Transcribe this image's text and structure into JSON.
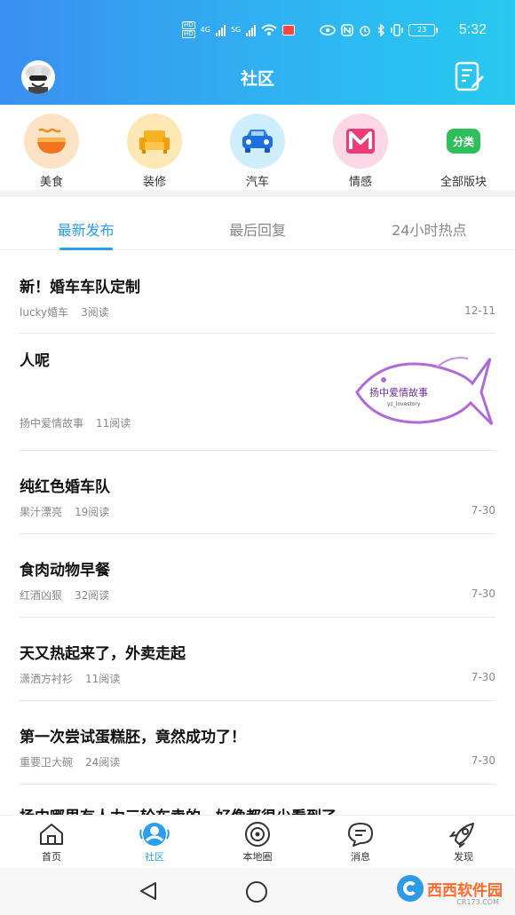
{
  "status_bar": {
    "hd1": "HD",
    "net1": "4G",
    "net2": "5G",
    "battery": "23",
    "time": "5:32"
  },
  "header": {
    "title": "社区"
  },
  "categories": [
    {
      "label": "美食",
      "icon": "noodle-bowl-icon",
      "color": "#fde3c6"
    },
    {
      "label": "装修",
      "icon": "sofa-icon",
      "color": "#fde7b4"
    },
    {
      "label": "汽车",
      "icon": "car-icon",
      "color": "#cfeefb"
    },
    {
      "label": "情感",
      "icon": "heart-m-icon",
      "color": "#fcd7e6"
    },
    {
      "label": "全部版块",
      "icon": "category-icon",
      "badge": "分类"
    }
  ],
  "tabs": [
    {
      "label": "最新发布",
      "active": true
    },
    {
      "label": "最后回复",
      "active": false
    },
    {
      "label": "24小时热点",
      "active": false
    }
  ],
  "posts": [
    {
      "title": "新！婚车车队定制",
      "author": "lucky婚车",
      "reads": "3阅读",
      "date": "12-11"
    },
    {
      "title": "人呢",
      "author": "扬中爱情故事",
      "reads": "11阅读",
      "date": "",
      "thumb_text": "扬中爱情故事",
      "thumb_sub": "yz_lovestory"
    },
    {
      "title": "纯红色婚车队",
      "author": "果汁漂亮",
      "reads": "19阅读",
      "date": "7-30"
    },
    {
      "title": "食肉动物早餐",
      "author": "红酒凶狠",
      "reads": "32阅读",
      "date": "7-30"
    },
    {
      "title": "天又热起来了，外卖走起",
      "author": "潇洒方衬衫",
      "reads": "11阅读",
      "date": "7-30"
    },
    {
      "title": "第一次尝试蛋糕胚，竟然成功了！",
      "author": "重要卫大碗",
      "reads": "24阅读",
      "date": "7-30"
    },
    {
      "title": "扬中哪里有人力三轮车卖的，好像都很少看到了",
      "author": "",
      "reads": "",
      "date": ""
    }
  ],
  "bottom_nav": [
    {
      "label": "首页",
      "icon": "home-icon",
      "active": false
    },
    {
      "label": "社区",
      "icon": "community-icon",
      "active": true
    },
    {
      "label": "本地圈",
      "icon": "local-circle-icon",
      "active": false
    },
    {
      "label": "消息",
      "icon": "message-icon",
      "active": false
    },
    {
      "label": "发现",
      "icon": "rocket-icon",
      "active": false
    }
  ],
  "watermark": {
    "text": "西西软件园",
    "sub": "CR173.COM"
  },
  "colors": {
    "accent": "#2a9ef0",
    "header_start": "#3a8ff0",
    "header_end": "#27c9f0"
  }
}
